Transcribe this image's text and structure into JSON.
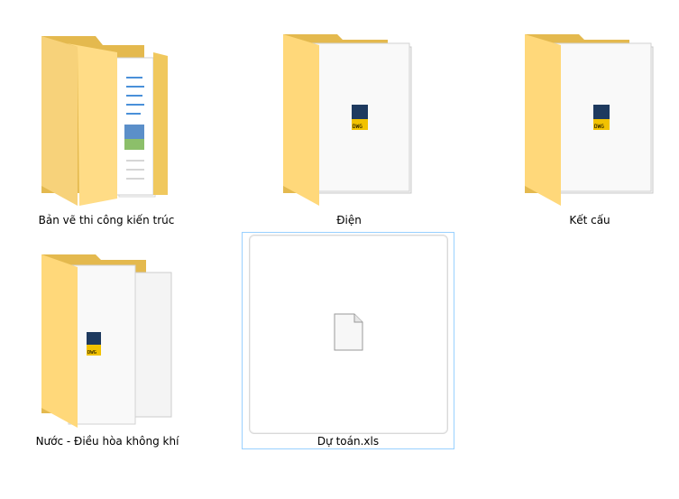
{
  "items": [
    {
      "name": "Bản vẽ thi công kiến trúc",
      "type": "folder-documents-icon"
    },
    {
      "name": "Điện",
      "type": "folder-dwg-icon"
    },
    {
      "name": "Kết cấu",
      "type": "folder-dwg-icon"
    },
    {
      "name": "Nước - Điều hòa không khí",
      "type": "folder-dwg-icon"
    },
    {
      "name": "Dự toán.xls",
      "type": "blank-file-icon"
    }
  ],
  "colors": {
    "folder_back": "#e8c15a",
    "folder_front": "#ffd87a",
    "selection_border": "#99d1ff"
  }
}
